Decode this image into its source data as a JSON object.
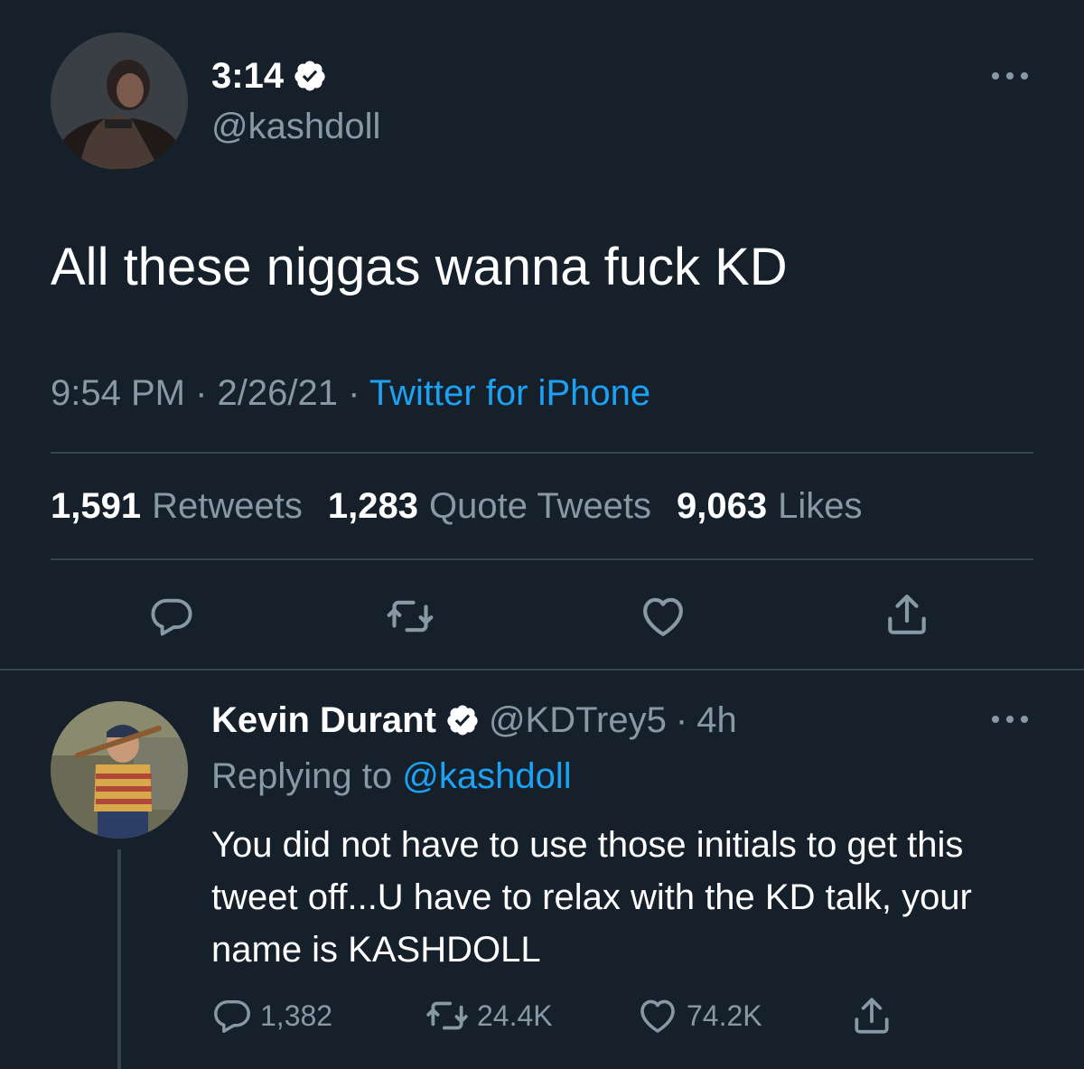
{
  "main_tweet": {
    "display_name": "3:14",
    "handle": "@kashdoll",
    "text": "All these niggas wanna fuck KD",
    "time": "9:54 PM",
    "date": "2/26/21",
    "source": "Twitter for iPhone",
    "separator": "·",
    "stats": {
      "retweets_count": "1,591",
      "retweets_label": "Retweets",
      "quotes_count": "1,283",
      "quotes_label": "Quote Tweets",
      "likes_count": "9,063",
      "likes_label": "Likes"
    }
  },
  "reply_tweet": {
    "display_name": "Kevin Durant",
    "handle": "@KDTrey5",
    "separator": "·",
    "time": "4h",
    "replying_prefix": "Replying to",
    "replying_to": "@kashdoll",
    "text": "You did not have to use those initials to get this tweet off...U have to relax with the KD talk, your name is KASHDOLL",
    "counts": {
      "replies": "1,382",
      "retweets": "24.4K",
      "likes": "74.2K"
    }
  },
  "icons": {
    "verified": "verified-badge-icon",
    "more": "more-options-icon",
    "reply": "reply-icon",
    "retweet": "retweet-icon",
    "like": "heart-icon",
    "share": "share-icon"
  },
  "colors": {
    "background": "#15202b",
    "text_primary": "#ffffff",
    "text_secondary": "#8899a6",
    "link": "#1da1f2",
    "divider": "#38444d"
  }
}
